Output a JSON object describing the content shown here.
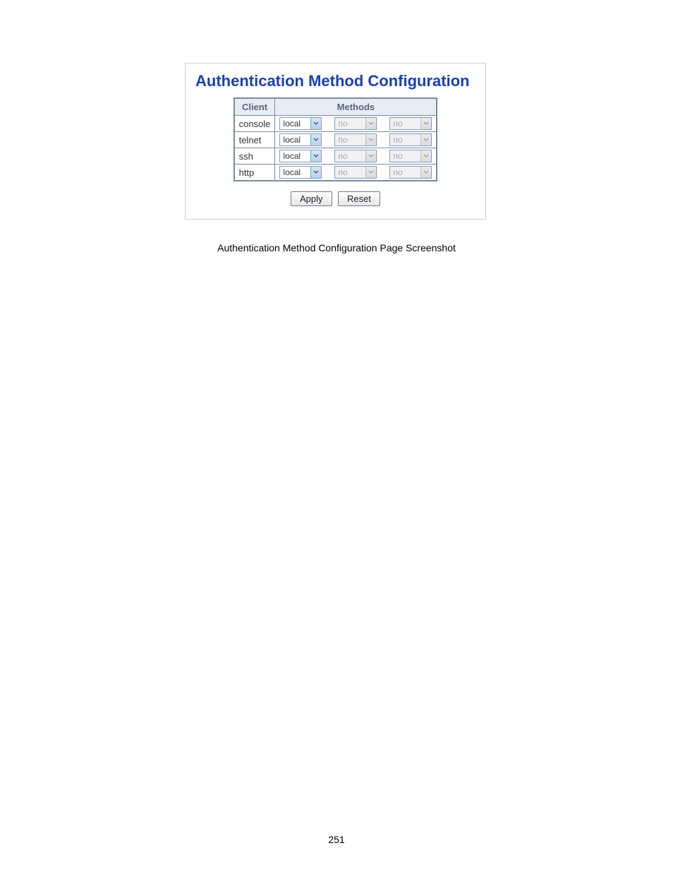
{
  "panel": {
    "title": "Authentication Method Configuration",
    "headers": {
      "client": "Client",
      "methods": "Methods"
    },
    "rows": [
      {
        "client": "console",
        "methods": [
          {
            "value": "local",
            "enabled": true
          },
          {
            "value": "no",
            "enabled": false
          },
          {
            "value": "no",
            "enabled": false
          }
        ]
      },
      {
        "client": "telnet",
        "methods": [
          {
            "value": "local",
            "enabled": true
          },
          {
            "value": "no",
            "enabled": false
          },
          {
            "value": "no",
            "enabled": false
          }
        ]
      },
      {
        "client": "ssh",
        "methods": [
          {
            "value": "local",
            "enabled": true
          },
          {
            "value": "no",
            "enabled": false
          },
          {
            "value": "no",
            "enabled": false
          }
        ]
      },
      {
        "client": "http",
        "methods": [
          {
            "value": "local",
            "enabled": true
          },
          {
            "value": "no",
            "enabled": false
          },
          {
            "value": "no",
            "enabled": false
          }
        ]
      }
    ],
    "buttons": {
      "apply": "Apply",
      "reset": "Reset"
    }
  },
  "caption": "Authentication Method Configuration Page Screenshot",
  "page_number": "251"
}
